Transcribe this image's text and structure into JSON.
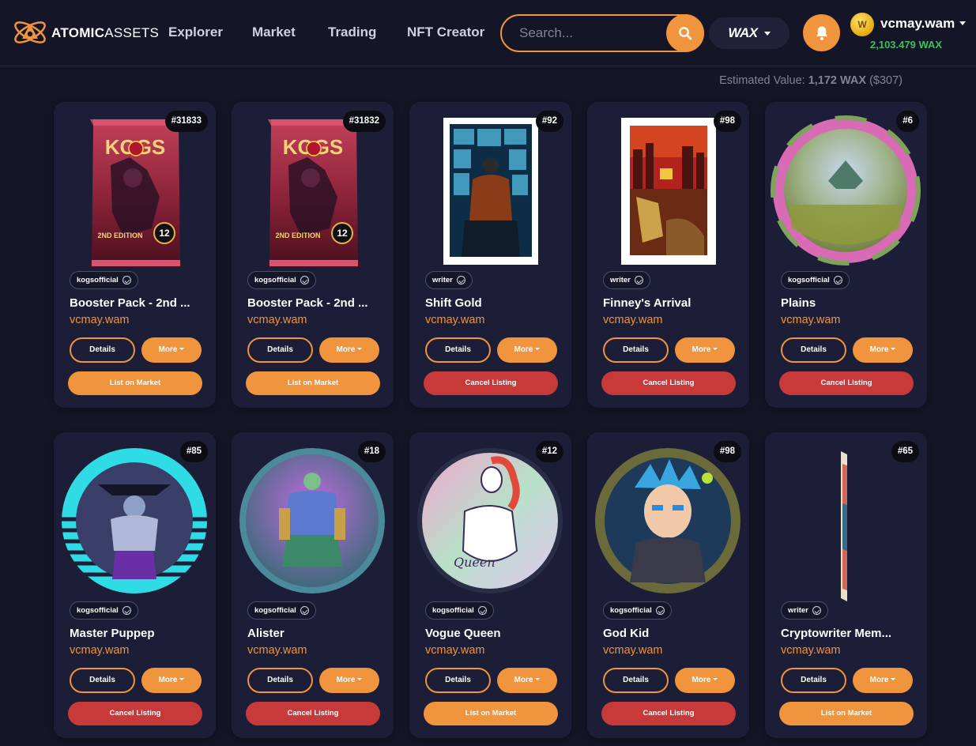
{
  "header": {
    "logo_bold": "ATOMIC",
    "logo_light": "ASSETS",
    "nav": [
      "Explorer",
      "Market",
      "Trading",
      "NFT Creator"
    ],
    "search_placeholder": "Search...",
    "chain": "WAX",
    "account": {
      "name": "vcmay.wam",
      "balance": "2,103.479 WAX",
      "coin_letter": "W"
    },
    "icons": {
      "search": "search-icon",
      "bell": "bell-icon",
      "dropdown": "chevron-down-icon"
    }
  },
  "estimate": {
    "label": "Estimated Value:",
    "wax": "1,172 WAX",
    "usd": "($307)"
  },
  "colors": {
    "accent": "#f0943d",
    "cancel": "#c8393a",
    "balance": "#3fbf5f",
    "background": "#141628",
    "card": "#1b1e36"
  },
  "cards": [
    {
      "mint": "#31833",
      "collection": "kogsofficial",
      "name": "Booster Pack - 2nd ...",
      "owner": "vcmay.wam",
      "details": "Details",
      "more": "More",
      "action": "List on Market",
      "action_type": "list",
      "art": "pack"
    },
    {
      "mint": "#31832",
      "collection": "kogsofficial",
      "name": "Booster Pack - 2nd ...",
      "owner": "vcmay.wam",
      "details": "Details",
      "more": "More",
      "action": "List on Market",
      "action_type": "list",
      "art": "pack"
    },
    {
      "mint": "#92",
      "collection": "writer",
      "name": "Shift Gold",
      "owner": "vcmay.wam",
      "details": "Details",
      "more": "More",
      "action": "Cancel Listing",
      "action_type": "cancel",
      "art": "shift"
    },
    {
      "mint": "#98",
      "collection": "writer",
      "name": "Finney's Arrival",
      "owner": "vcmay.wam",
      "details": "Details",
      "more": "More",
      "action": "Cancel Listing",
      "action_type": "cancel",
      "art": "finney"
    },
    {
      "mint": "#6",
      "collection": "kogsofficial",
      "name": "Plains",
      "owner": "vcmay.wam",
      "details": "Details",
      "more": "More",
      "action": "Cancel Listing",
      "action_type": "cancel",
      "art": "plains"
    },
    {
      "mint": "#85",
      "collection": "kogsofficial",
      "name": "Master Puppep",
      "owner": "vcmay.wam",
      "details": "Details",
      "more": "More",
      "action": "Cancel Listing",
      "action_type": "cancel",
      "art": "puppep"
    },
    {
      "mint": "#18",
      "collection": "kogsofficial",
      "name": "Alister",
      "owner": "vcmay.wam",
      "details": "Details",
      "more": "More",
      "action": "Cancel Listing",
      "action_type": "cancel",
      "art": "alister"
    },
    {
      "mint": "#12",
      "collection": "kogsofficial",
      "name": "Vogue Queen",
      "owner": "vcmay.wam",
      "details": "Details",
      "more": "More",
      "action": "List on Market",
      "action_type": "list",
      "art": "vogue"
    },
    {
      "mint": "#98",
      "collection": "kogsofficial",
      "name": "God Kid",
      "owner": "vcmay.wam",
      "details": "Details",
      "more": "More",
      "action": "Cancel Listing",
      "action_type": "cancel",
      "art": "godkid"
    },
    {
      "mint": "#65",
      "collection": "writer",
      "name": "Cryptowriter Mem...",
      "owner": "vcmay.wam",
      "details": "Details",
      "more": "More",
      "action": "List on Market",
      "action_type": "list",
      "art": "crypto"
    }
  ]
}
